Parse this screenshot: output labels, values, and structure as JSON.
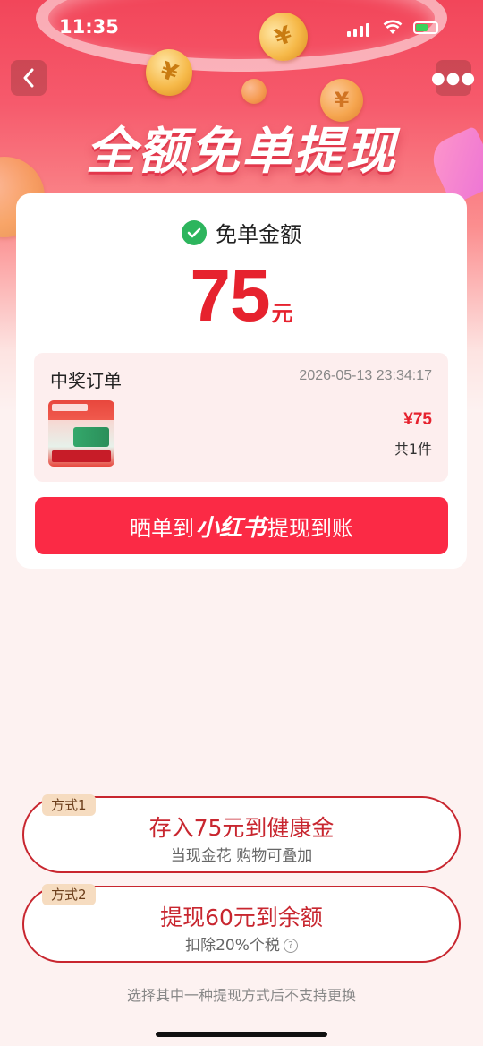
{
  "status_bar": {
    "time": "11:35"
  },
  "header": {
    "title": "全额免单提现",
    "back_icon": "chevron-left-icon",
    "more_icon": "more-dots-icon"
  },
  "amount": {
    "label": "免单金额",
    "value": "75",
    "unit": "元"
  },
  "order": {
    "title": "中奖订单",
    "time": "2026-05-13 23:34:17",
    "price": "¥75",
    "quantity": "共1件"
  },
  "share_button": {
    "prefix": "晒单到",
    "brand": "小红书",
    "suffix": "提现到账"
  },
  "options": [
    {
      "tag": "方式1",
      "title": "存入75元到健康金",
      "subtitle": "当现金花 购物可叠加"
    },
    {
      "tag": "方式2",
      "title": "提现60元到余额",
      "subtitle": "扣除20%个税"
    }
  ],
  "footer_note": "选择其中一种提现方式后不支持更换",
  "colors": {
    "accent": "#fb2a45",
    "amount": "#e6222e",
    "success": "#2db55d"
  }
}
